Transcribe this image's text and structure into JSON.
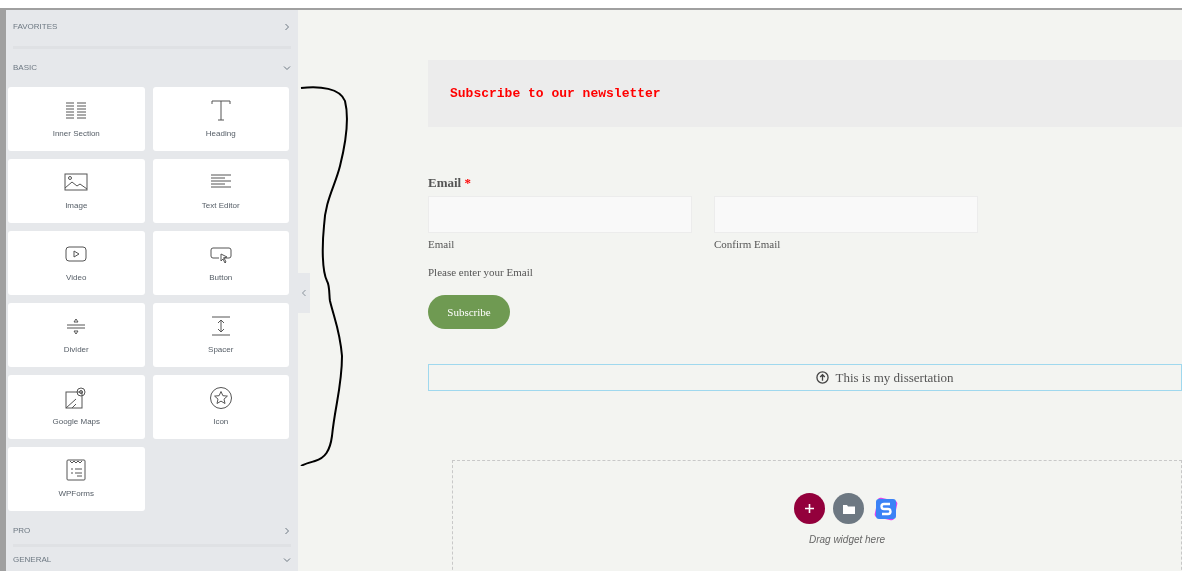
{
  "sidebar": {
    "sections_top": [
      {
        "title": "FAVORITES",
        "expanded": false
      },
      {
        "title": "BASIC",
        "expanded": true
      }
    ],
    "widgets": [
      {
        "kind": "inner-section",
        "label": "Inner Section"
      },
      {
        "kind": "heading",
        "label": "Heading"
      },
      {
        "kind": "image",
        "label": "Image"
      },
      {
        "kind": "text-editor",
        "label": "Text Editor"
      },
      {
        "kind": "video",
        "label": "Video"
      },
      {
        "kind": "button",
        "label": "Button"
      },
      {
        "kind": "divider",
        "label": "Divider"
      },
      {
        "kind": "spacer",
        "label": "Spacer"
      },
      {
        "kind": "map",
        "label": "Google Maps"
      },
      {
        "kind": "star",
        "label": "Icon"
      },
      {
        "kind": "form",
        "label": "WPForms"
      }
    ],
    "sections_bottom": [
      {
        "title": "PRO",
        "expanded": false
      },
      {
        "title": "GENERAL",
        "expanded": true
      }
    ]
  },
  "canvas": {
    "newsletter_heading": "Subscribe to our newsletter",
    "form": {
      "label": "Email",
      "required_mark": "*",
      "fields": [
        {
          "sublabel": "Email"
        },
        {
          "sublabel": "Confirm Email"
        }
      ],
      "hint": "Please enter your Email",
      "submit": "Subscribe"
    },
    "dissertation_bar": "This is my dissertation",
    "drop_zone": {
      "hint": "Drag widget here"
    }
  }
}
